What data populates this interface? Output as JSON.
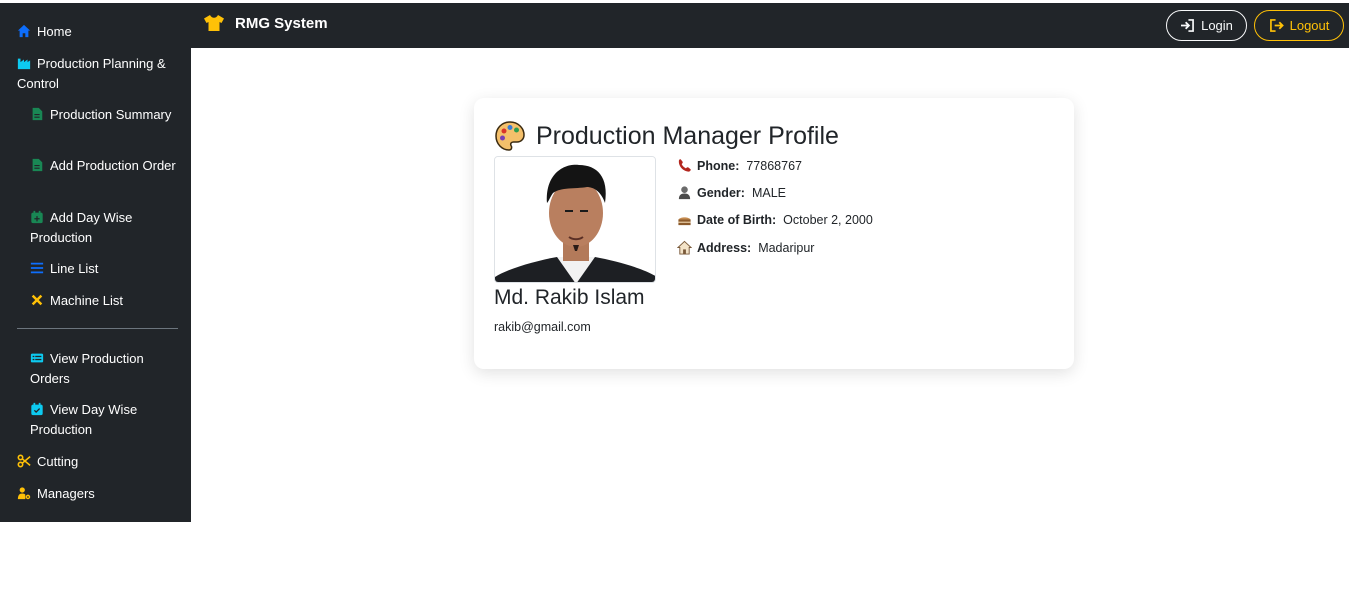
{
  "app": {
    "brand": "RMG System"
  },
  "header": {
    "login_label": "Login",
    "logout_label": "Logout"
  },
  "sidebar": {
    "items": [
      {
        "label": "Home"
      },
      {
        "label": "Production Planning & Control"
      },
      {
        "label": "Production Summary"
      },
      {
        "label": "Add Production Order"
      },
      {
        "label": "Add Day Wise Production"
      },
      {
        "label": "Line List"
      },
      {
        "label": "Machine List"
      },
      {
        "label": "View Production Orders"
      },
      {
        "label": "View Day Wise Production"
      },
      {
        "label": "Cutting"
      },
      {
        "label": "Managers"
      }
    ]
  },
  "profile": {
    "title": "Production Manager Profile",
    "name": "Md. Rakib Islam",
    "email": "rakib@gmail.com",
    "phone_label": "Phone:",
    "phone": "77868767",
    "gender_label": "Gender:",
    "gender": "MALE",
    "dob_label": "Date of Birth:",
    "dob": "October 2, 2000",
    "address_label": "Address:",
    "address": "Madaripur"
  },
  "colors": {
    "dark": "#212529",
    "accent_yellow": "#ffc107",
    "accent_cyan": "#0dcaf0",
    "accent_green": "#198754",
    "accent_blue": "#0d6efd"
  }
}
